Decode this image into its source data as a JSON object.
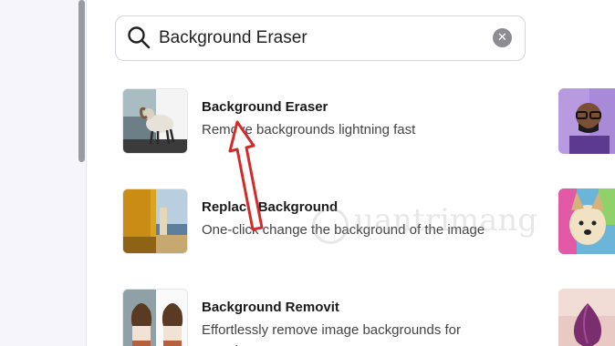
{
  "search": {
    "value": "Background Eraser",
    "icon": "search-icon",
    "clear_icon": "clear-icon",
    "clear_glyph": "✕"
  },
  "results": [
    {
      "title": "Background Eraser",
      "description": "Remove backgrounds lightning fast",
      "thumbnail": "ram-on-rock-image"
    },
    {
      "title": "Replace Background",
      "description": "One-click change the background of the image",
      "thumbnail": "yellow-wall-seascape-image"
    },
    {
      "title": "Background Removit",
      "description": "Effortlessly remove image backgrounds for",
      "description_line2": "seamless",
      "thumbnail": "woman-portrait-split-image"
    }
  ],
  "side_thumbnails": [
    "man-glasses-purple-image",
    "shiba-dog-art-image",
    "purple-onion-image"
  ],
  "watermark": "uantrimang",
  "colors": {
    "annotation_arrow": "#d42a2a",
    "side_thumb_1": "#b79ae0",
    "clear_button": "#8c8c92"
  }
}
